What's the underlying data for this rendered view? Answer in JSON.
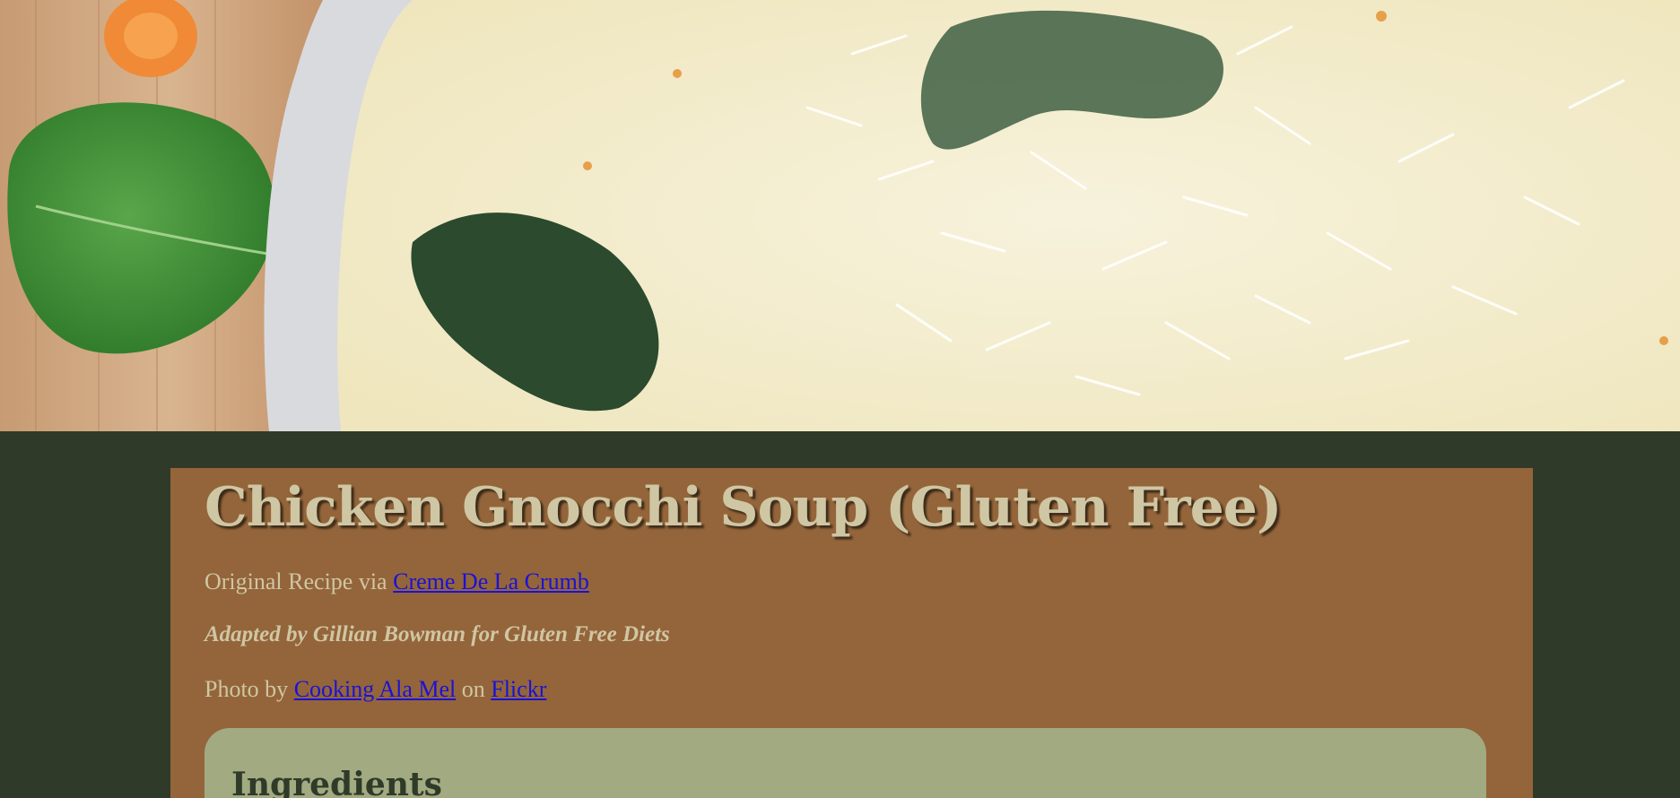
{
  "hero": {
    "image_alt": "Chicken gnocchi soup topped with grated parmesan, spinach leaf and carrot slice"
  },
  "recipe": {
    "title": "Chicken Gnocchi Soup (Gluten Free)",
    "original_prefix": "Original Recipe via",
    "original_link": "Creme De La Crumb",
    "adapted": "Adapted by Gillian Bowman for Gluten Free Diets",
    "photo_prefix": "Photo by",
    "photo_author_link": "Cooking Ala Mel",
    "photo_on": "on",
    "photo_site_link": "Flickr"
  },
  "ingredients": {
    "heading": "Ingredients"
  },
  "colors": {
    "page_bg": "#2f3a29",
    "card_bg": "#94653a",
    "title_text": "#cfc6a4",
    "link": "#1a12d6",
    "ingredients_bg": "#a2aa82"
  }
}
